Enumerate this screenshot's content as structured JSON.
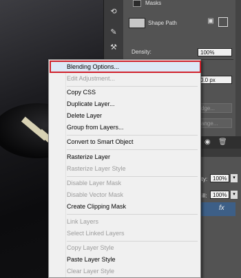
{
  "panel": {
    "masks_title": "Masks",
    "shape_path": "Shape Path",
    "density_label": "Density:",
    "density_value": "100%",
    "feather_value": "0.0 px",
    "edge_label": "dge...",
    "range_label": "ange...",
    "opacity_label": "ity:",
    "opacity_value": "100%",
    "fill_label": "ill:",
    "fill_value": "100%",
    "fx_label": "fx"
  },
  "menu": {
    "items": [
      {
        "label": "Blending Options...",
        "enabled": true,
        "highlighted": true
      },
      {
        "label": "Edit Adjustment...",
        "enabled": false
      },
      {
        "label": "Copy CSS",
        "enabled": true
      },
      {
        "label": "Duplicate Layer...",
        "enabled": true
      },
      {
        "label": "Delete Layer",
        "enabled": true
      },
      {
        "label": "Group from Layers...",
        "enabled": true
      },
      {
        "label": "Convert to Smart Object",
        "enabled": true
      },
      {
        "label": "Rasterize Layer",
        "enabled": true
      },
      {
        "label": "Rasterize Layer Style",
        "enabled": false
      },
      {
        "label": "Disable Layer Mask",
        "enabled": false
      },
      {
        "label": "Disable Vector Mask",
        "enabled": false
      },
      {
        "label": "Create Clipping Mask",
        "enabled": true
      },
      {
        "label": "Link Layers",
        "enabled": false
      },
      {
        "label": "Select Linked Layers",
        "enabled": false
      },
      {
        "label": "Copy Layer Style",
        "enabled": false
      },
      {
        "label": "Paste Layer Style",
        "enabled": true
      },
      {
        "label": "Clear Layer Style",
        "enabled": false
      }
    ]
  },
  "colors": {
    "highlight_border": "#d0202a",
    "menu_bg": "#f0f0f0",
    "panel_bg": "#535353"
  }
}
